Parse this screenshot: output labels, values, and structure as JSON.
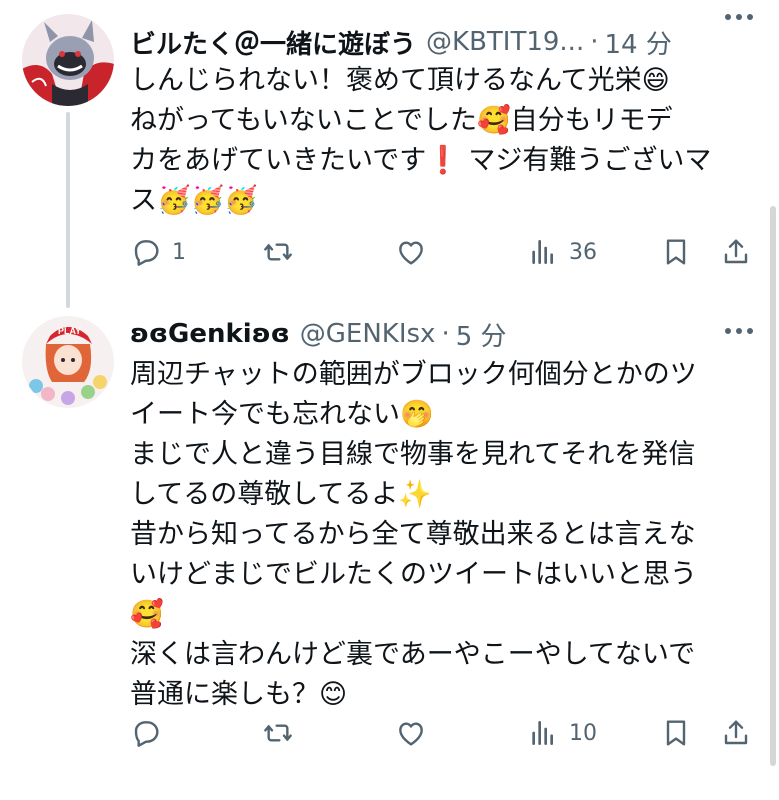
{
  "colors": {
    "text": "#0f1419",
    "secondary": "#536471",
    "thread_line": "#cfd9de"
  },
  "tweets": [
    {
      "display_name": "ビルたく＠一緒に遊ぼう",
      "handle": "@KBTIT19...",
      "separator": "·",
      "time": "14 分",
      "body_lines": [
        "しんじられない！褒めて頂けるなんて光栄😄",
        "ねがってもいないことでした🥰自分もリモデ",
        "カをあげていきたいです❗ マジ有難うございマ",
        "ス🥳🥳🥳"
      ],
      "reply_count": "1",
      "retweet_count": "",
      "like_count": "",
      "view_count": "36",
      "icons": [
        "reply-icon",
        "retweet-icon",
        "like-icon",
        "views-icon",
        "bookmark-icon",
        "share-icon"
      ]
    },
    {
      "display_name": "ʚɞGenkiʚɞ",
      "handle": "@GENKIsx",
      "separator": "·",
      "time": "5 分",
      "body_lines": [
        "周辺チャットの範囲がブロック何個分とかのツ",
        "イート今でも忘れない🤭",
        "まじで人と違う目線で物事を見れてそれを発信",
        "してるの尊敬してるよ✨",
        "昔から知ってるから全て尊敬出来るとは言えな",
        "いけどまじでビルたくのツイートはいいと思う",
        "🥰",
        "深くは言わんけど裏であーやこーやしてないで",
        "普通に楽しも？😊"
      ],
      "reply_count": "",
      "retweet_count": "",
      "like_count": "",
      "view_count": "10",
      "icons": [
        "reply-icon",
        "retweet-icon",
        "like-icon",
        "views-icon",
        "bookmark-icon",
        "share-icon"
      ]
    }
  ]
}
